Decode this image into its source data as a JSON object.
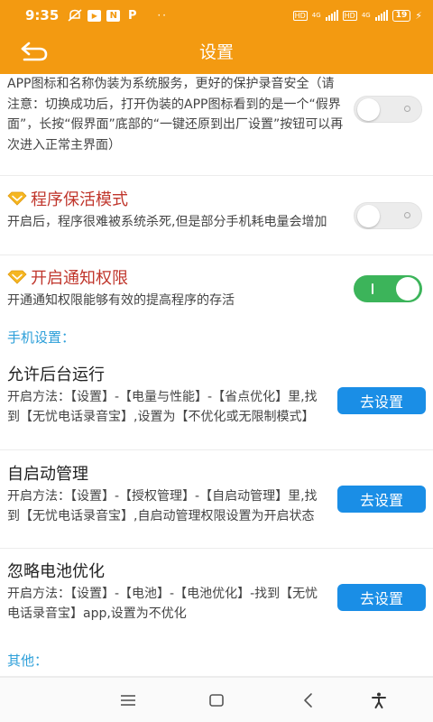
{
  "status_bar": {
    "time": "9:35",
    "app_icon_n": "N",
    "app_icon_p": "P",
    "dots": "··",
    "hd1": "HD",
    "net1": "4G",
    "hd2": "HD",
    "net2": "4G",
    "battery": "19"
  },
  "appbar": {
    "title": "设置"
  },
  "disguise": {
    "desc": "APP图标和名称伪装为系统服务，更好的保护录音安全（请注意：切换成功后，打开伪装的APP图标看到的是一个“假界面”，长按“假界面”底部的“一键还原到出厂设置”按钮可以再次进入正常主界面）",
    "enabled": false
  },
  "keepalive": {
    "title": "程序保活模式",
    "desc": "开启后，程序很难被系统杀死,但是部分手机耗电量会增加",
    "enabled": false
  },
  "notify": {
    "title": "开启通知权限",
    "desc": "开通通知权限能够有效的提高程序的存活",
    "enabled": true
  },
  "phone_section": "手机设置：",
  "background": {
    "title": "允许后台运行",
    "desc": "开启方法：【设置】-【电量与性能】-【省点优化】里,找到【无忧电话录音宝】,设置为【不优化或无限制模式】",
    "button": "去设置"
  },
  "autostart": {
    "title": "自启动管理",
    "desc": "开启方法：【设置】-【授权管理】-【自启动管理】里,找到【无忧电话录音宝】,自启动管理权限设置为开启状态",
    "button": "去设置"
  },
  "battery_opt": {
    "title": "忽略电池优化",
    "desc": "开启方法：【设置】-【电池】-【电池优化】-找到【无忧电话录音宝】app,设置为不优化",
    "button": "去设置"
  },
  "other_section": "其他：",
  "colors": {
    "accent": "#f39a11",
    "feature_title": "#c0362c",
    "section": "#2c9fd9",
    "button": "#1a8ee6",
    "toggle_on": "#3cb45a"
  }
}
